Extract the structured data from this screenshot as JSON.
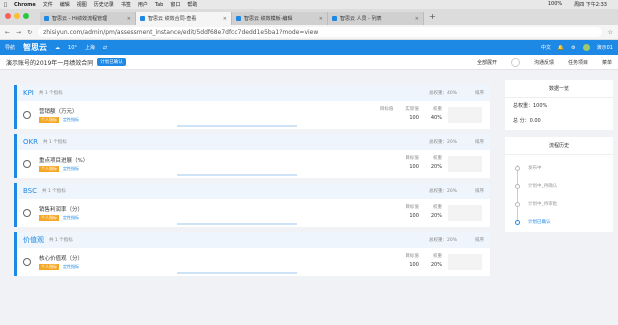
{
  "mac_menu": {
    "apple": "",
    "app": "Chrome",
    "items": [
      "文件",
      "编辑",
      "视图",
      "历史记录",
      "书签",
      "用户",
      "Tab",
      "窗口",
      "帮助"
    ],
    "battery": "100%",
    "clock": "周四 下午2:33"
  },
  "browser": {
    "tabs": [
      {
        "title": "智思云 - Hi绩效流程管理",
        "active": false
      },
      {
        "title": "智思云 绩效合同-查看",
        "active": true
      },
      {
        "title": "智思云 绩效模板-编辑",
        "active": false
      },
      {
        "title": "智思云 人员 - 列表",
        "active": false
      }
    ],
    "new_tab": "+",
    "url": "zhisiyun.com/admin/pm/assessment_instance/edit/5ddf68e7dfcc7dedd1e5ba1?mode=view"
  },
  "app_header": {
    "nav": "导航",
    "logo": "智思云",
    "weather": "10°",
    "city": "上海",
    "lang": "中文",
    "user": "演示01"
  },
  "titlebar": {
    "title": "演示账号的2019年一月绩效合同",
    "badge": "计划已确认",
    "expand": "全部展开",
    "feedback": "沟通反馈",
    "tasks": "任务项目",
    "menu": "菜单"
  },
  "sections": [
    {
      "name": "KPI",
      "count": "共 1 个指标",
      "weight": "总权重：40%",
      "sort": "排序",
      "item": {
        "title": "营销额（万元）",
        "tag1": "个人指标",
        "tag2": "定性指标",
        "target_label": "目标值",
        "target": "",
        "actual_label": "实际值",
        "actual": "100",
        "weight_label": "权重",
        "weight": "40%"
      }
    },
    {
      "name": "OKR",
      "count": "共 1 个指标",
      "weight": "总权重：20%",
      "sort": "排序",
      "item": {
        "title": "重点项目进展（%）",
        "tag1": "个人指标",
        "tag2": "定性指标",
        "target_label": "目标值",
        "target": "100",
        "actual_label": "",
        "actual": "",
        "weight_label": "权重",
        "weight": "20%"
      }
    },
    {
      "name": "BSC",
      "count": "共 1 个指标",
      "weight": "总权重：20%",
      "sort": "排序",
      "item": {
        "title": "销售利润率（分）",
        "tag1": "个人指标",
        "tag2": "定性指标",
        "target_label": "目标值",
        "target": "100",
        "actual_label": "",
        "actual": "",
        "weight_label": "权重",
        "weight": "20%"
      }
    },
    {
      "name": "价值观",
      "count": "共 1 个指标",
      "weight": "总权重：20%",
      "sort": "排序",
      "item": {
        "title": "核心价值观（分）",
        "tag1": "个人指标",
        "tag2": "定性指标",
        "target_label": "目标值",
        "target": "100",
        "actual_label": "",
        "actual": "",
        "weight_label": "权重",
        "weight": "20%"
      }
    }
  ],
  "summary": {
    "title": "数据一览",
    "total_weight": "总权重：100%",
    "total_score": "总 分：0.00"
  },
  "process": {
    "title": "流程历史",
    "steps": [
      "发布中",
      "计划中_待确认",
      "计划中_待审批",
      "计划已确认"
    ]
  }
}
